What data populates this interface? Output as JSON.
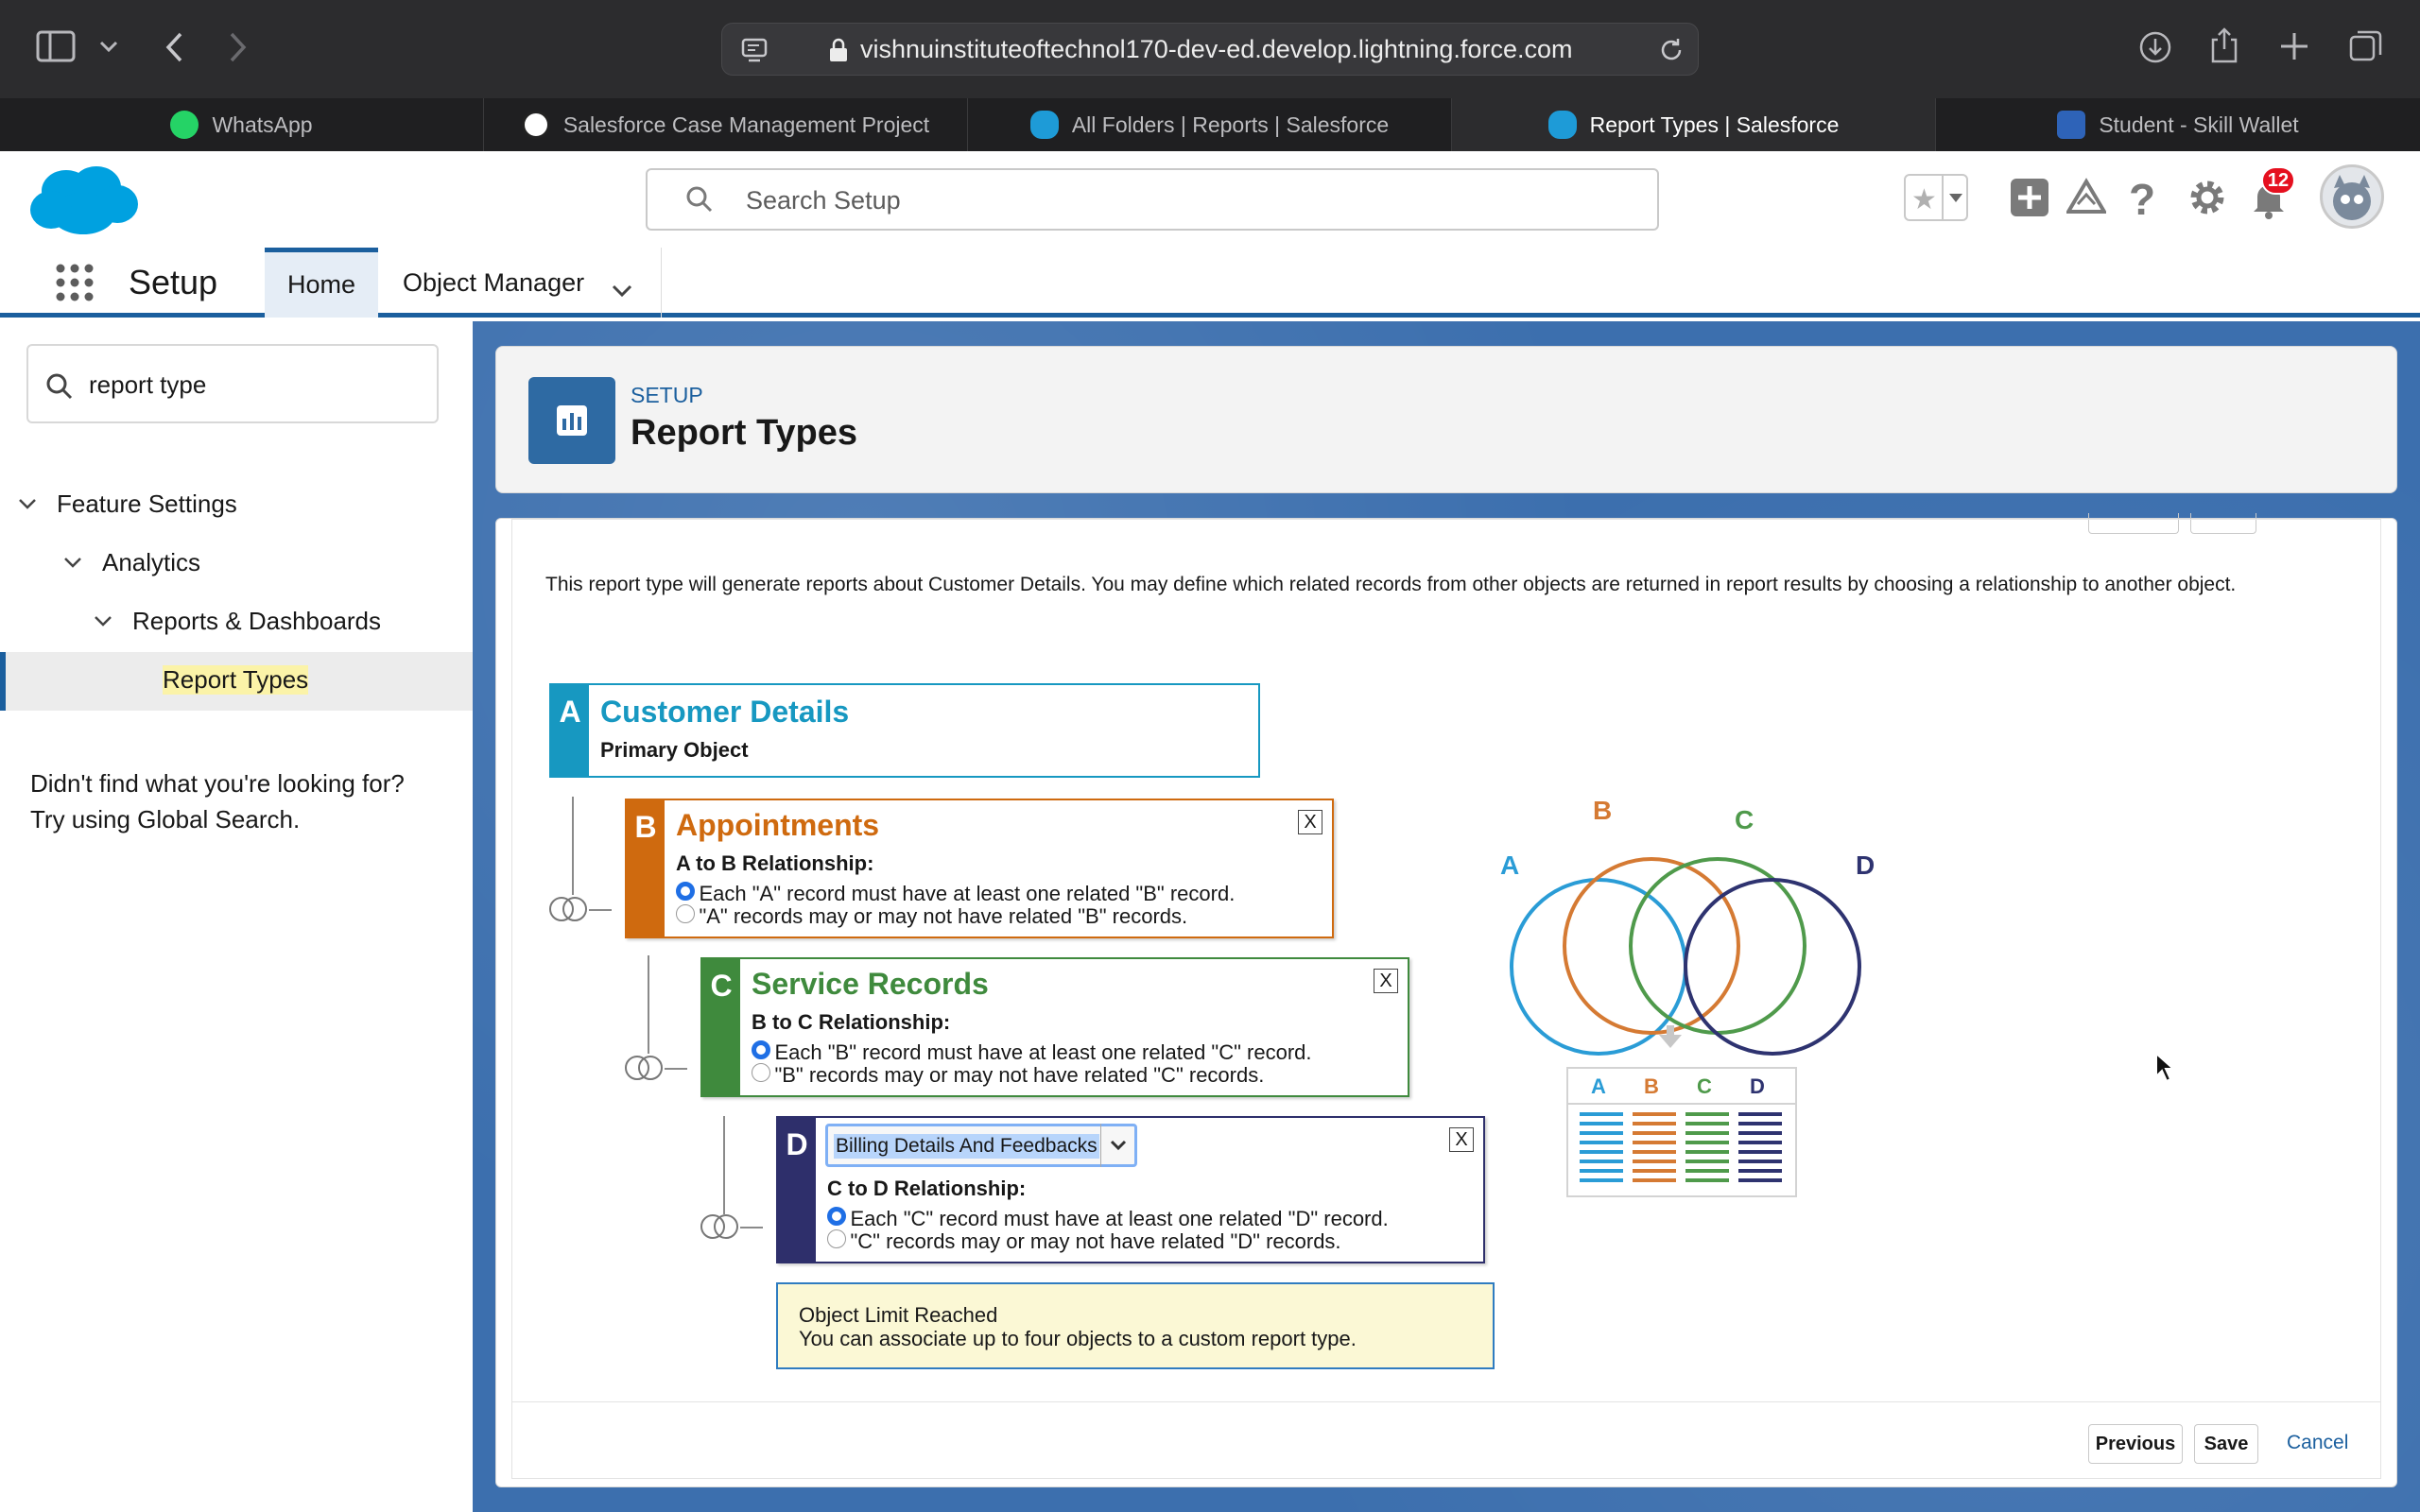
{
  "browser": {
    "url": "vishnuinstituteoftechnol170-dev-ed.develop.lightning.force.com",
    "tabs": [
      {
        "label": "WhatsApp"
      },
      {
        "label": "Salesforce Case Management Project"
      },
      {
        "label": "All Folders | Reports | Salesforce"
      },
      {
        "label": "Report Types | Salesforce"
      },
      {
        "label": "Student - Skill Wallet"
      }
    ],
    "tab_close_glyph": "×"
  },
  "header": {
    "search_placeholder": "Search Setup",
    "notification_count": "12"
  },
  "nav": {
    "app_name": "Setup",
    "tabs": [
      {
        "label": "Home"
      },
      {
        "label": "Object Manager"
      }
    ]
  },
  "sidebar": {
    "search_value": "report type",
    "tree": [
      {
        "label": "Feature Settings"
      },
      {
        "label": "Analytics"
      },
      {
        "label": "Reports & Dashboards"
      },
      {
        "label": "Report Types"
      }
    ],
    "help_line1": "Didn't find what you're looking for?",
    "help_line2": "Try using Global Search."
  },
  "page_header": {
    "eyebrow": "SETUP",
    "title": "Report Types"
  },
  "content": {
    "description": "This report type will generate reports about Customer Details. You may define which related records from other objects are returned in report results by choosing a relationship to another object.",
    "objects": {
      "a": {
        "letter": "A",
        "title": "Customer Details",
        "subtitle": "Primary Object",
        "color": "#1798c1"
      },
      "b": {
        "letter": "B",
        "title": "Appointments",
        "rel_heading": "A to B Relationship:",
        "opt1": "Each \"A\" record must have at least one related \"B\" record.",
        "opt2": "\"A\" records may or may not have related \"B\" records.",
        "color": "#cf6a0f"
      },
      "c": {
        "letter": "C",
        "title": "Service Records",
        "rel_heading": "B to C Relationship:",
        "opt1": "Each \"B\" record must have at least one related \"C\" record.",
        "opt2": "\"B\" records may or may not have related \"C\" records.",
        "color": "#3f8a3d"
      },
      "d": {
        "letter": "D",
        "select_value": "Billing Details And Feedbacks",
        "rel_heading": "C to D Relationship:",
        "opt1": "Each \"C\" record must have at least one related \"D\" record.",
        "opt2": "\"C\" records may or may not have related \"D\" records.",
        "color": "#2e2f6b"
      }
    },
    "close_label": "X",
    "limit_title": "Object Limit Reached",
    "limit_text": "You can associate up to four objects to a custom report type.",
    "buttons": {
      "previous": "Previous",
      "save": "Save",
      "cancel": "Cancel"
    }
  },
  "diagram": {
    "labels": [
      "A",
      "B",
      "C",
      "D"
    ]
  }
}
